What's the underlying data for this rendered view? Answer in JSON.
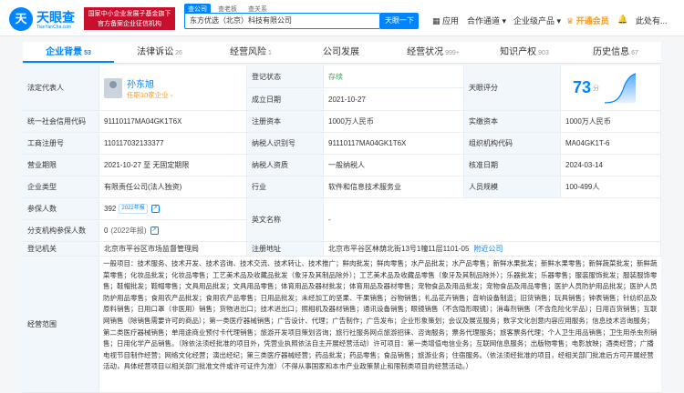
{
  "header": {
    "logo_mark": "天",
    "logo_name": "天眼查",
    "logo_sub": "TianYanCha.com",
    "gov_line1": "国家中小企业发展子基金旗下",
    "gov_line2": "官方备案企业征信机构",
    "search_tabs": [
      "查公司",
      "查老板",
      "查关系"
    ],
    "search_value": "东方优选（北京）科技有限公司",
    "search_button": "天眼一下",
    "nav": [
      "应用",
      "合作通道",
      "企业级产品",
      "开通会员",
      "此处有..."
    ]
  },
  "tabs": [
    {
      "label": "企业背景",
      "count": "53"
    },
    {
      "label": "法律诉讼",
      "count": "26"
    },
    {
      "label": "经营风险",
      "count": "1"
    },
    {
      "label": "公司发展",
      "count": ""
    },
    {
      "label": "经营状况",
      "count": "999+"
    },
    {
      "label": "知识产权",
      "count": "903"
    },
    {
      "label": "历史信息",
      "count": "67"
    }
  ],
  "info": {
    "legal_rep_label": "法定代表人",
    "legal_rep_name": "孙东旭",
    "legal_rep_sub": "任职10家企业 ›",
    "status_label": "登记状态",
    "status_value": "存续",
    "founded_label": "成立日期",
    "founded_value": "2021-10-27",
    "score_label": "天眼评分",
    "score_value": "73",
    "score_unit": "分",
    "credit_code_label": "统一社会信用代码",
    "credit_code_value": "91110117MA04GK1T6X",
    "reg_capital_label": "注册资本",
    "reg_capital_value": "1000万人民币",
    "paid_capital_label": "实缴资本",
    "paid_capital_value": "1000万人民币",
    "biz_reg_label": "工商注册号",
    "biz_reg_value": "110117032133377",
    "taxpayer_id_label": "纳税人识别号",
    "taxpayer_id_value": "91110117MA04GK1T6X",
    "org_code_label": "组织机构代码",
    "org_code_value": "MA04GK1T-6",
    "term_label": "营业期限",
    "term_value": "2021-10-27 至 无固定期限",
    "taxpayer_q_label": "纳税人资质",
    "taxpayer_q_value": "一般纳税人",
    "approval_label": "核准日期",
    "approval_value": "2024-03-14",
    "type_label": "企业类型",
    "type_value": "有限责任公司(法人独资)",
    "industry_label": "行业",
    "industry_value": "软件和信息技术服务业",
    "size_label": "人员规模",
    "size_value": "100-499人",
    "insured_label": "参保人数",
    "insured_value": "392",
    "insured_tag": "2022年报",
    "en_name_label": "英文名称",
    "en_name_value": "-",
    "branch_label": "分支机构参保人数",
    "branch_value": "0",
    "branch_year": "(2022年报)",
    "authority_label": "登记机关",
    "authority_value": "北京市平谷区市场监督管理局",
    "address_label": "注册地址",
    "address_value": "北京市平谷区林荫北街13号1幢11层1101-05",
    "address_link": "附近公司",
    "scope_label": "经营范围",
    "scope_value": "一般项目：技术服务、技术开发、技术咨询、技术交流、技术转让、技术推广；鲜肉批发；鲜肉零售；水产品批发；水产品零售；新鲜水果批发；新鲜水果零售；新鲜蔬菜批发；新鲜蔬菜零售；化妆品批发；化妆品零售；工艺美术品及收藏品批发（象牙及其制品除外）；工艺美术品及收藏品零售（象牙及其制品除外）；乐器批发；乐器零售；服装服饰批发；服装服饰零售；鞋帽批发；鞋帽零售；文具用品批发；文具用品零售；体育用品及器材批发；体育用品及器材零售；宠物食品及用品批发；宠物食品及用品零售；医护人员防护用品批发；医护人员防护用品零售；食用农产品批发；食用农产品零售；日用品批发；未经加工的坚果、干果销售；谷物销售；礼品花卉销售；音响设备制造；旧货销售；玩具销售；钟表销售；针纺织品及原料销售；日用口罩（非医用）销售；货物进出口；技术进出口；照相机及器材销售；通讯设备销售；眼镜销售（不含隐形眼镜）；消毒剂销售（不含危险化学品）；日用百货销售；互联网销售（除销售需要许可的商品）；第一类医疗器械销售；广告设计、代理；广告制作；广告发布；企业形象策划；会议及展览服务；数字文化创意内容应用服务；信息技术咨询服务；第二类医疗器械销售；单用途商业预付卡代理销售；旅游开发项目策划咨询；旅行社服务网点旅游招徕、咨询服务；票务代理服务；旅客票务代理；个人卫生用品销售；卫生用杀虫剂销售；日用化学产品销售。（除依法须经批准的项目外，凭营业执照依法自主开展经营活动）许可项目：第一类增值电信业务；互联网信息服务；出版物零售；电影放映；酒类经营；广播电视节目制作经营；网络文化经营；演出经纪；第三类医疗器械经营；药品批发；药品零售；食品销售；旅游业务；住宿服务。（依法须经批准的项目，经相关部门批准后方可开展经营活动，具体经营项目以相关部门批准文件或许可证件为准）（不得从事国家和本市产业政策禁止和限制类项目的经营活动。）"
  },
  "colors": {
    "accent": "#0084ff",
    "status_green": "#2bb24c",
    "label_bg": "#f2f7fc",
    "gov_red": "#c8102e",
    "vip": "#f59a23"
  }
}
